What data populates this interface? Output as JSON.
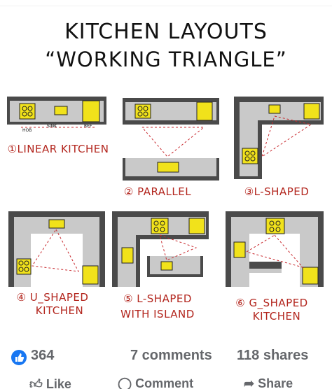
{
  "title": {
    "line1": "KITCHEN LAYOUTS",
    "line2": "“WORKING TRIANGLE”"
  },
  "diagram_labels": {
    "hob": "HOB",
    "sink": "SINK",
    "ref": "REF",
    "linear": "①LINEAR KITCHEN",
    "parallel": "② PARALLEL",
    "lshaped": "③L-SHAPED",
    "ushaped_1": "④ U_SHAPED",
    "ushaped_2": "KITCHEN",
    "lisland_1": "⑤ L-SHAPED",
    "lisland_2": "WITH ISLAND",
    "gshaped_1": "⑥ G_SHAPED",
    "gshaped_2": "KITCHEN"
  },
  "colors": {
    "wall": "#4a4a4a",
    "counter": "#c9c9c9",
    "appliance": "#f1e21b",
    "triangle": "#c8282d",
    "accent": "#1877f2"
  },
  "social": {
    "like_icon": "thumbs-up-icon",
    "like_count": "364",
    "comments": "7 comments",
    "shares": "118 shares",
    "like_label": "Like",
    "comment_label": "Comment",
    "share_label": "Share"
  }
}
